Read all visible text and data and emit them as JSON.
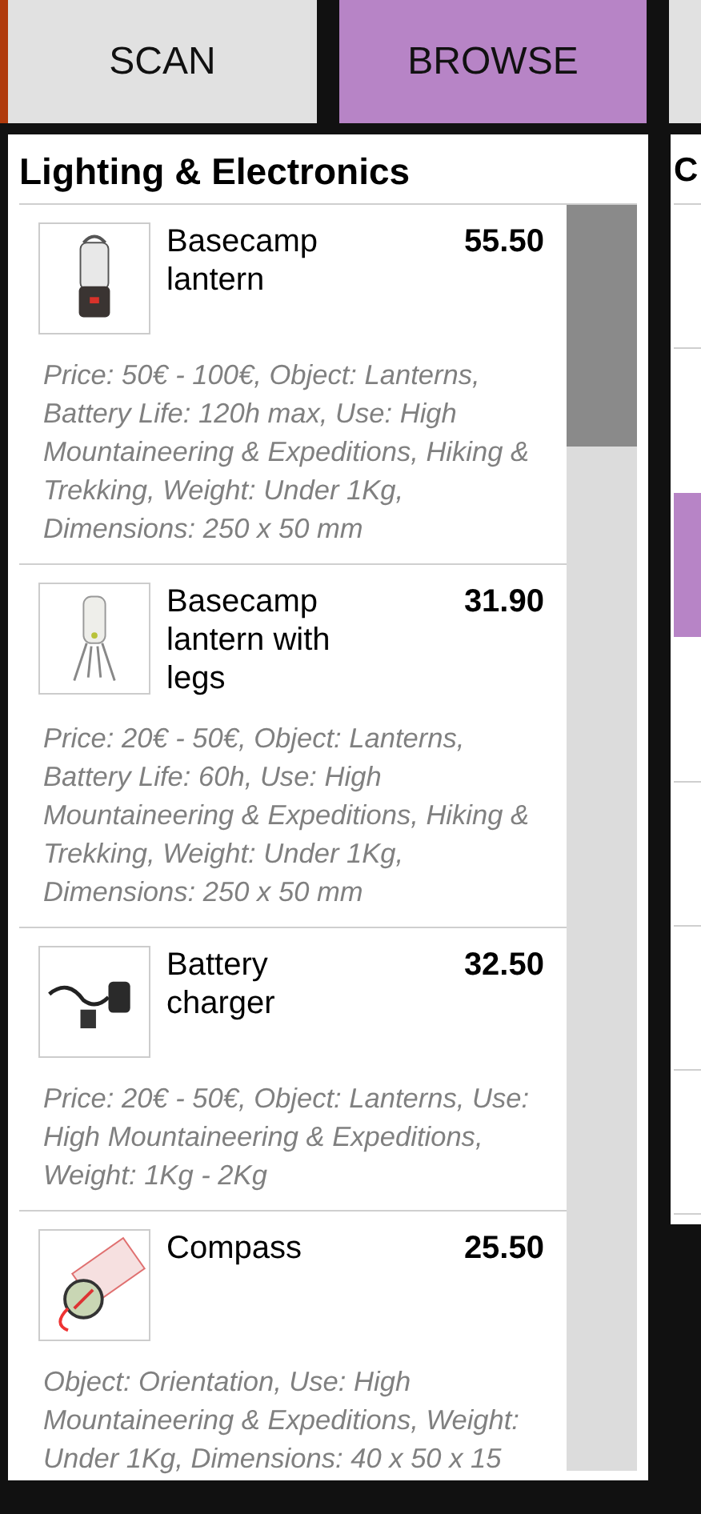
{
  "tabs": [
    {
      "label": "SCAN",
      "selected": false
    },
    {
      "label": "BROWSE",
      "selected": true
    },
    {
      "selected": false
    }
  ],
  "category": {
    "title": "Lighting & Electronics",
    "products": [
      {
        "name": "Basecamp lantern",
        "price": "55.50",
        "description": "Price: 50€ - 100€, Object: Lanterns, Battery Life: 120h max, Use: High Mountaineering & Expeditions, Hiking & Trekking, Weight: Under 1Kg, Dimensions: 250 x 50 mm"
      },
      {
        "name": "Basecamp lantern with legs",
        "price": "31.90",
        "description": "Price: 20€ - 50€, Object: Lanterns, Battery Life: 60h, Use: High Mountaineering & Expeditions, Hiking & Trekking, Weight: Under 1Kg, Dimensions: 250 x 50 mm"
      },
      {
        "name": "Battery charger",
        "price": "32.50",
        "description": "Price: 20€ - 50€, Object: Lanterns, Use: High Mountaineering & Expeditions, Weight: 1Kg - 2Kg"
      },
      {
        "name": "Compass",
        "price": "25.50",
        "description": "Object: Orientation, Use: High Mountaineering & Expeditions, Weight: Under 1Kg, Dimensions: 40 x 50 x 15"
      }
    ]
  },
  "next_category": {
    "title": "C"
  }
}
